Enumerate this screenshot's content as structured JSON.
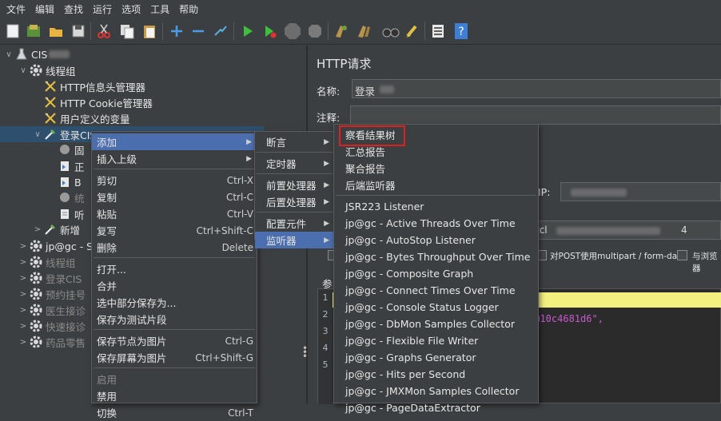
{
  "menubar": [
    "文件",
    "编辑",
    "查找",
    "运行",
    "选项",
    "工具",
    "帮助"
  ],
  "tree": [
    {
      "label": "CIS",
      "arrow": "∨",
      "icon": "flask-icon",
      "blur": true,
      "dim": false,
      "sel": false
    },
    {
      "label": "线程组",
      "arrow": "∨",
      "icon": "gear-icon",
      "blur": false,
      "dim": false,
      "sel": false
    },
    {
      "label": "HTTP信息头管理器",
      "arrow": "",
      "icon": "wrench-icon",
      "blur": false,
      "dim": false,
      "sel": false
    },
    {
      "label": "HTTP Cookie管理器",
      "arrow": "",
      "icon": "wrench-icon",
      "blur": false,
      "dim": false,
      "sel": false
    },
    {
      "label": "用户定义的变量",
      "arrow": "",
      "icon": "wrench-icon",
      "blur": false,
      "dim": false,
      "sel": false
    },
    {
      "label": "登录CIS",
      "arrow": "∨",
      "icon": "pipette-icon",
      "blur": false,
      "dim": false,
      "sel": true
    },
    {
      "label": "固",
      "arrow": "",
      "icon": "timer-icon",
      "blur": false,
      "dim": false,
      "sel": false
    },
    {
      "label": "正",
      "arrow": "",
      "icon": "extractor-icon",
      "blur": false,
      "dim": false,
      "sel": false
    },
    {
      "label": "B",
      "arrow": "",
      "icon": "extractor-icon",
      "blur": false,
      "dim": false,
      "sel": false
    },
    {
      "label": "统",
      "arrow": "",
      "icon": "timer-icon",
      "blur": false,
      "dim": true,
      "sel": false
    },
    {
      "label": "听",
      "arrow": "",
      "icon": "listener-icon",
      "blur": false,
      "dim": false,
      "sel": false
    },
    {
      "label": "新增",
      "arrow": ">",
      "icon": "pipette-icon",
      "blur": false,
      "dim": false,
      "sel": false
    },
    {
      "label": "jp@gc - S",
      "arrow": ">",
      "icon": "gear-icon",
      "blur": false,
      "dim": false,
      "sel": false
    },
    {
      "label": "线程组",
      "arrow": ">",
      "icon": "gear-icon",
      "blur": false,
      "dim": true,
      "sel": false
    },
    {
      "label": "登录CIS",
      "arrow": ">",
      "icon": "gear-icon",
      "blur": false,
      "dim": true,
      "sel": false
    },
    {
      "label": "预约挂号",
      "arrow": ">",
      "icon": "gear-icon",
      "blur": false,
      "dim": true,
      "sel": false
    },
    {
      "label": "医生接诊",
      "arrow": ">",
      "icon": "gear-icon",
      "blur": false,
      "dim": true,
      "sel": false
    },
    {
      "label": "快速接诊",
      "arrow": ">",
      "icon": "gear-icon",
      "blur": false,
      "dim": true,
      "sel": false
    },
    {
      "label": "药品零售",
      "arrow": ">",
      "icon": "gear-icon",
      "blur": false,
      "dim": true,
      "sel": false
    }
  ],
  "right": {
    "title": "HTTP请求",
    "name_label": "名称:",
    "name_value": "登录",
    "comment_label": "注释:",
    "ip_label": "IP:",
    "path_fragment": "tcl",
    "path_suffix": "4",
    "multipart_label": "对POST使用multipart / form-data",
    "browser_label": "与浏览器",
    "param_label": "参",
    "code_lines": [
      "1",
      "2",
      "3",
      "4",
      "5"
    ],
    "code_fragment": "4@10c4681d6\","
  },
  "ctx_menu": [
    {
      "label": "添加",
      "key": "",
      "sub": true,
      "active": true,
      "dis": false
    },
    {
      "label": "插入上级",
      "key": "",
      "sub": true,
      "active": false,
      "dis": false
    },
    {
      "sep": true
    },
    {
      "label": "剪切",
      "key": "Ctrl-X",
      "sub": false,
      "active": false,
      "dis": false
    },
    {
      "label": "复制",
      "key": "Ctrl-C",
      "sub": false,
      "active": false,
      "dis": false
    },
    {
      "label": "粘贴",
      "key": "Ctrl-V",
      "sub": false,
      "active": false,
      "dis": false
    },
    {
      "label": "复写",
      "key": "Ctrl+Shift-C",
      "sub": false,
      "active": false,
      "dis": false
    },
    {
      "label": "删除",
      "key": "Delete",
      "sub": false,
      "active": false,
      "dis": false
    },
    {
      "sep": true
    },
    {
      "label": "打开...",
      "key": "",
      "sub": false,
      "active": false,
      "dis": false
    },
    {
      "label": "合并",
      "key": "",
      "sub": false,
      "active": false,
      "dis": false
    },
    {
      "label": "选中部分保存为...",
      "key": "",
      "sub": false,
      "active": false,
      "dis": false
    },
    {
      "label": "保存为测试片段",
      "key": "",
      "sub": false,
      "active": false,
      "dis": false
    },
    {
      "sep": true
    },
    {
      "label": "保存节点为图片",
      "key": "Ctrl-G",
      "sub": false,
      "active": false,
      "dis": false
    },
    {
      "label": "保存屏幕为图片",
      "key": "Ctrl+Shift-G",
      "sub": false,
      "active": false,
      "dis": false
    },
    {
      "sep": true
    },
    {
      "label": "启用",
      "key": "",
      "sub": false,
      "active": false,
      "dis": true
    },
    {
      "label": "禁用",
      "key": "",
      "sub": false,
      "active": false,
      "dis": false
    },
    {
      "label": "切换",
      "key": "Ctrl-T",
      "sub": false,
      "active": false,
      "dis": false
    }
  ],
  "add_menu": [
    {
      "label": "断言",
      "active": false
    },
    {
      "sep": true
    },
    {
      "label": "定时器",
      "active": false
    },
    {
      "sep": true
    },
    {
      "label": "前置处理器",
      "active": false
    },
    {
      "label": "后置处理器",
      "active": false
    },
    {
      "sep": true
    },
    {
      "label": "配置元件",
      "active": false
    },
    {
      "label": "监听器",
      "active": true
    }
  ],
  "listener_menu": [
    {
      "label": "察看结果树"
    },
    {
      "label": "汇总报告"
    },
    {
      "label": "聚合报告"
    },
    {
      "label": "后端监听器"
    },
    {
      "sep": true
    },
    {
      "label": "JSR223 Listener"
    },
    {
      "label": "jp@gc - Active Threads Over Time"
    },
    {
      "label": "jp@gc - AutoStop Listener"
    },
    {
      "label": "jp@gc - Bytes Throughput Over Time"
    },
    {
      "label": "jp@gc - Composite Graph"
    },
    {
      "label": "jp@gc - Connect Times Over Time"
    },
    {
      "label": "jp@gc - Console Status Logger"
    },
    {
      "label": "jp@gc - DbMon Samples Collector"
    },
    {
      "label": "jp@gc - Flexible File Writer"
    },
    {
      "label": "jp@gc - Graphs Generator"
    },
    {
      "label": "jp@gc - Hits per Second"
    },
    {
      "label": "jp@gc - JMXMon Samples Collector"
    },
    {
      "label": "jp@gc - PageDataExtractor"
    }
  ],
  "colors": {
    "highlight": "#e0201c",
    "menu_active": "#4b6eaf",
    "bg": "#3c3f41"
  }
}
